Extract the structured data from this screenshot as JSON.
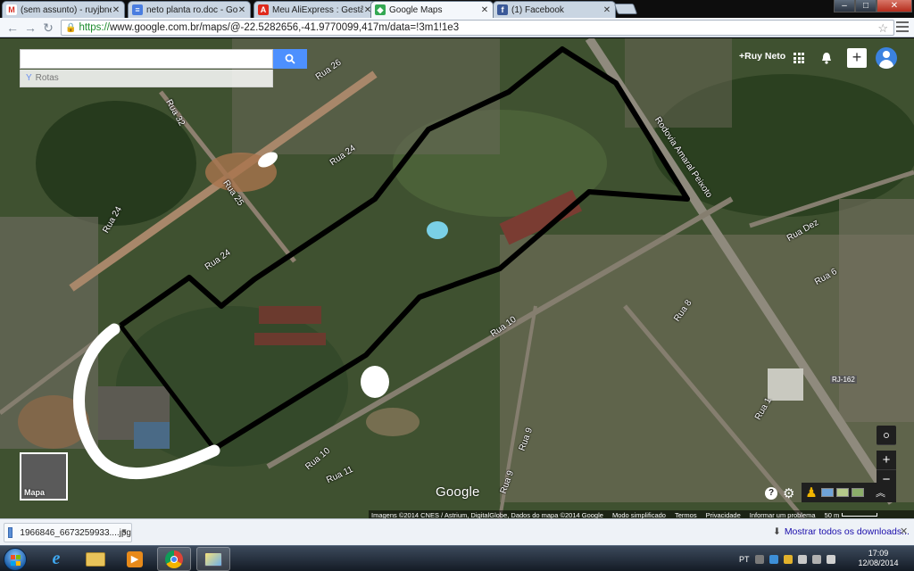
{
  "browser": {
    "tabs": [
      {
        "title": "(sem assunto) - ruyjbneto",
        "icon": "gmail-icon",
        "color": "#d93025",
        "glyph": "M"
      },
      {
        "title": "neto planta ro.doc - Goog",
        "icon": "docs-icon",
        "color": "#4a7de0",
        "glyph": "≡"
      },
      {
        "title": "Meu AliExpress : Gestão d",
        "icon": "aliexpress-icon",
        "color": "#e02a1d",
        "glyph": "A"
      },
      {
        "title": "Google Maps",
        "icon": "maps-icon",
        "color": "#34a853",
        "glyph": "◆",
        "active": true
      },
      {
        "title": "(1) Facebook",
        "icon": "facebook-icon",
        "color": "#3b5998",
        "glyph": "f"
      }
    ],
    "url_scheme": "https://",
    "url_rest": "www.google.com.br/maps/@-22.5282656,-41.9770099,417m/data=!3m1!1e3",
    "window_buttons": {
      "minimize": "–",
      "maximize": "□",
      "close": "✕"
    }
  },
  "maps": {
    "search_placeholder": "",
    "routes_label": "Rotas",
    "account_name": "+Ruy Neto",
    "minimap_label": "Mapa",
    "logo": "Google",
    "street_labels": [
      {
        "text": "Rua 26"
      },
      {
        "text": "Rua 32"
      },
      {
        "text": "Rua 24"
      },
      {
        "text": "Rua 25"
      },
      {
        "text": "Rua 24"
      },
      {
        "text": "Rua 24"
      },
      {
        "text": "Rodovia Amaral Peixoto"
      },
      {
        "text": "Rua 10"
      },
      {
        "text": "Rua 10"
      },
      {
        "text": "Rua 11"
      },
      {
        "text": "Rua 9"
      },
      {
        "text": "Rua 9"
      },
      {
        "text": "Rua 8"
      },
      {
        "text": "Rua 1"
      },
      {
        "text": "Rua Dez"
      },
      {
        "text": "Rua 6"
      },
      {
        "text": "RJ-162"
      }
    ],
    "footer": {
      "imagery": "Imagens ©2014 CNES / Astrium, DigitalGlobe, Dados do mapa ©2014 Google",
      "simplified": "Modo simplificado",
      "terms": "Termos",
      "privacy": "Privacidade",
      "report": "Informar um problema",
      "scale": "50 m"
    },
    "zoom": {
      "in": "+",
      "out": "−"
    }
  },
  "downloads": {
    "file_name": "1966846_6673259933....jpg",
    "show_all": "Mostrar todos os downloads...",
    "close": "✕"
  },
  "taskbar": {
    "language": "PT",
    "time": "17:09",
    "date": "12/08/2014",
    "apps": [
      "ie-icon",
      "explorer-icon",
      "media-player-icon",
      "chrome-icon",
      "paint-icon"
    ]
  }
}
